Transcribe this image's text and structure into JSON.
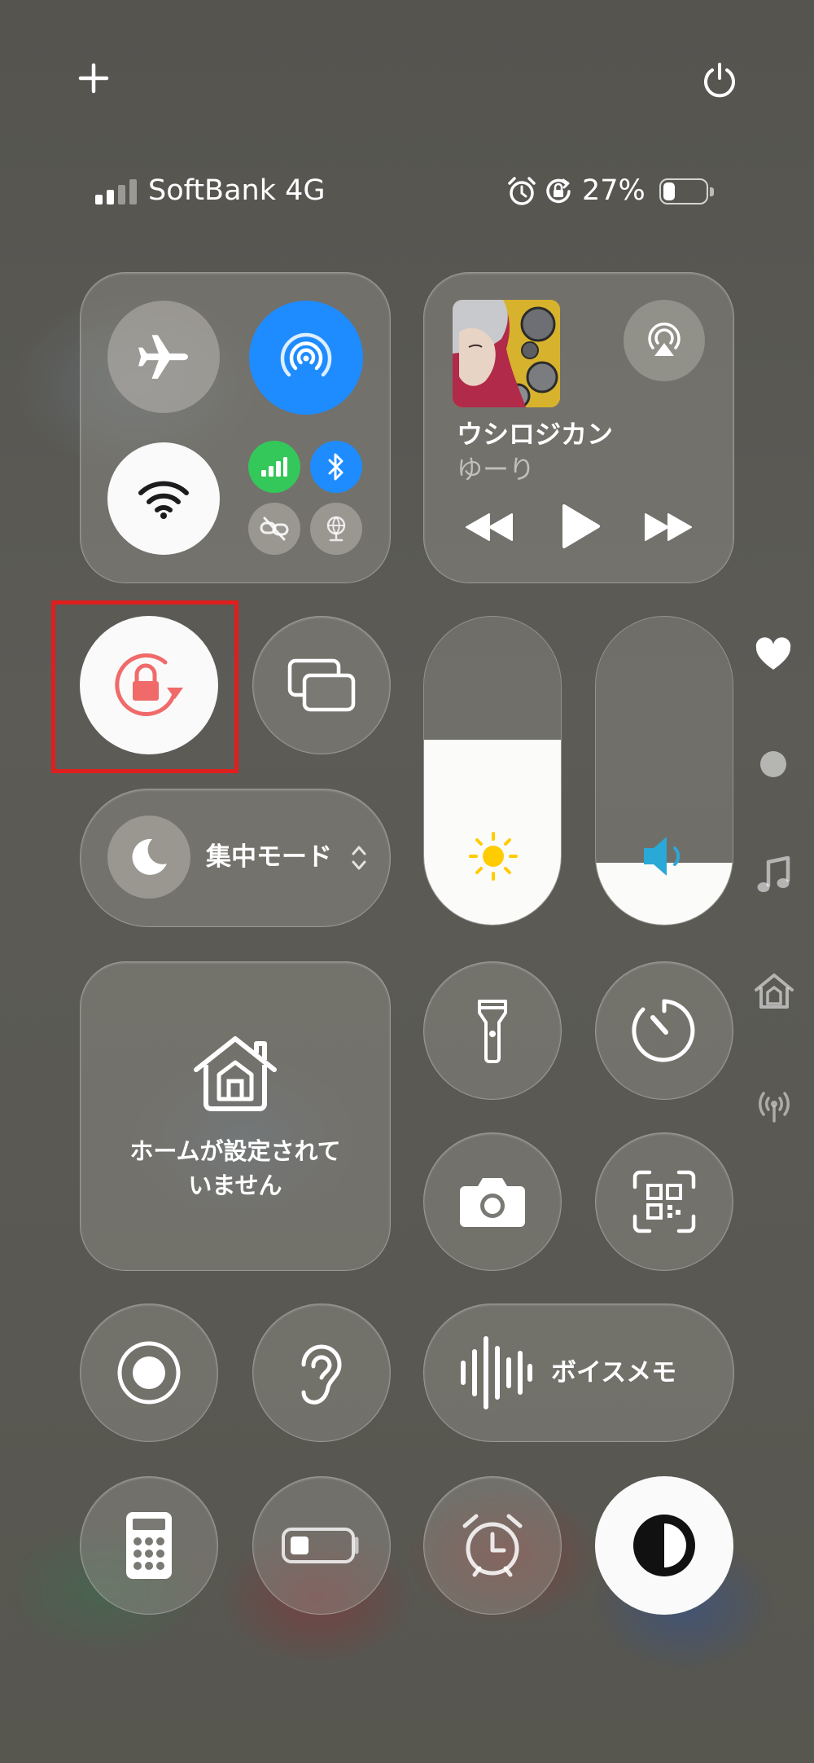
{
  "status_bar": {
    "carrier": "SoftBank 4G",
    "battery_percent": "27%",
    "battery_level": 0.27,
    "signal_bars": 2
  },
  "top_controls": {
    "add_icon": "plus-icon",
    "power_icon": "power-icon"
  },
  "now_playing": {
    "title": "ウシロジカン",
    "artist": "ゆーり"
  },
  "focus": {
    "label": "集中モード"
  },
  "home": {
    "line1": "ホームが設定されて",
    "line2": "いません"
  },
  "voice_memo": {
    "label": "ボイスメモ"
  },
  "sliders": {
    "brightness_level": 0.6,
    "volume_level": 0.2
  },
  "side_pages": [
    "heart-icon",
    "dot-icon",
    "music-icon",
    "home-icon",
    "antenna-icon"
  ],
  "colors": {
    "accent_blue": "#1e8cff",
    "cellular_green": "#34c759",
    "orientation_lock_red": "#f06a6a",
    "highlight_red": "#e01e1e",
    "sun_yellow": "#ffcc00",
    "speaker_blue": "#2aa8d8"
  }
}
